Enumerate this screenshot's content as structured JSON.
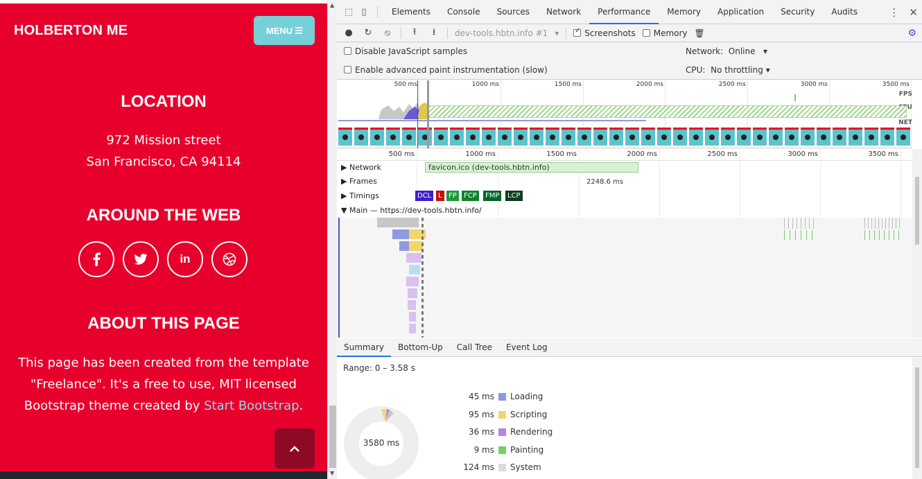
{
  "site": {
    "brand": "HOLBERTON ME",
    "menu_label": "MENU",
    "location_title": "LOCATION",
    "address_line1": "972 Mission street",
    "address_line2": "San Francisco, CA 94114",
    "web_title": "AROUND THE WEB",
    "socials": [
      "f",
      "t",
      "in",
      "dr"
    ],
    "about_title": "ABOUT THIS PAGE",
    "about_text_1": "This page has been created from the template",
    "about_text_2": "\"Freelance\". It's a free to use, MIT licensed",
    "about_text_3": "Bootstrap theme created by ",
    "about_link": "Start Bootstrap",
    "about_text_4": ".",
    "colors": {
      "background": "#e8002d",
      "menu": "#77cfd9",
      "link": "#8fdbe4",
      "to_top": "#8e0a24"
    }
  },
  "devtools": {
    "tabs": [
      "Elements",
      "Console",
      "Sources",
      "Network",
      "Performance",
      "Memory",
      "Application",
      "Security",
      "Audits"
    ],
    "active_tab": "Performance",
    "toolbar": {
      "profile": "dev-tools.hbtn.info #1",
      "screenshots_label": "Screenshots",
      "memory_label": "Memory"
    },
    "settings": {
      "disable_js": "Disable JavaScript samples",
      "paint_instr": "Enable advanced paint instrumentation (slow)",
      "network_label": "Network:",
      "network_value": "Online",
      "cpu_label": "CPU:",
      "cpu_value": "No throttling"
    },
    "overview_ticks": [
      "500 ms",
      "1000 ms",
      "1500 ms",
      "2000 ms",
      "2500 ms",
      "3000 ms",
      "3500 ms"
    ],
    "overview_labels": {
      "fps": "FPS",
      "cpu": "CPU",
      "net": "NET"
    },
    "flame_ticks": [
      "500 ms",
      "1000 ms",
      "1500 ms",
      "2000 ms",
      "2500 ms",
      "3000 ms",
      "3500 ms"
    ],
    "tracks": {
      "network": "Network",
      "network_item": "favicon.ico (dev-tools.hbtn.info)",
      "frames": "Frames",
      "frame_time": "2248.6 ms",
      "timings": "Timings",
      "main": "Main — https://dev-tools.hbtn.info/"
    },
    "timing_markers": [
      {
        "label": "DCL",
        "color": "#3c1fc9"
      },
      {
        "label": "L",
        "color": "#c60f0f"
      },
      {
        "label": "FP",
        "color": "#1c9b3a"
      },
      {
        "label": "FCP",
        "color": "#10812e"
      },
      {
        "label": "FMP",
        "color": "#06652a"
      },
      {
        "label": "LCP",
        "color": "#0c3e1f"
      }
    ],
    "summary_tabs": [
      "Summary",
      "Bottom-Up",
      "Call Tree",
      "Event Log"
    ],
    "range": "Range: 0 – 3.58 s",
    "total": "3580 ms",
    "breakdown": [
      {
        "value": "45 ms",
        "label": "Loading",
        "color": "#8e9ae0"
      },
      {
        "value": "95 ms",
        "label": "Scripting",
        "color": "#f2d66c"
      },
      {
        "value": "36 ms",
        "label": "Rendering",
        "color": "#b287e0"
      },
      {
        "value": "9 ms",
        "label": "Painting",
        "color": "#77cf6c"
      },
      {
        "value": "124 ms",
        "label": "System",
        "color": "#dcdcdc"
      }
    ]
  }
}
